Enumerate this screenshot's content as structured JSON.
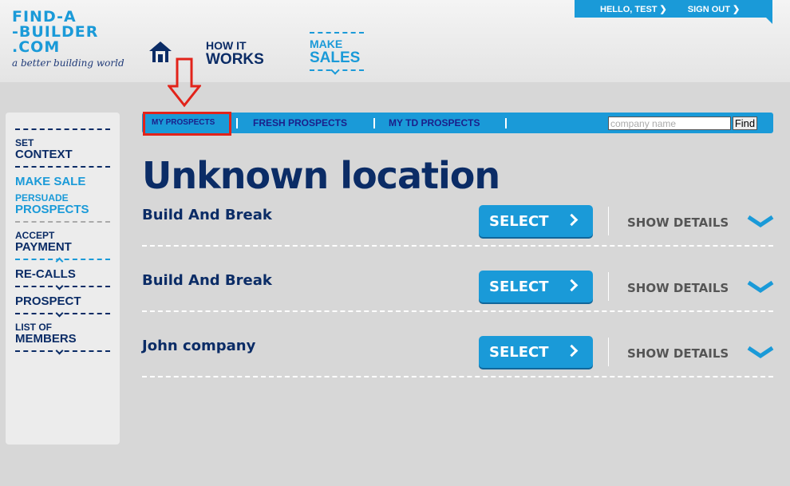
{
  "user_bar": {
    "greeting": "HELLO, TEST",
    "sign_out": "SIGN OUT"
  },
  "logo": {
    "line1": "FIND-A",
    "line2": "-BUILDER",
    "line3": ".COM",
    "tagline": "a better building world"
  },
  "top_nav": {
    "how_it_small": "HOW IT",
    "how_it_big": "WORKS",
    "make_small": "MAKE",
    "make_big": "SALES"
  },
  "sidebar": {
    "items": [
      {
        "small": "SET",
        "big": "CONTEXT"
      },
      {
        "big": "MAKE SALE"
      },
      {
        "small": "PERSUADE",
        "big": "PROSPECTS"
      },
      {
        "small": "ACCEPT",
        "big": "PAYMENT"
      },
      {
        "big": "RE-CALLS"
      },
      {
        "big": "PROSPECT"
      },
      {
        "small": "LIST OF",
        "big": "MEMBERS"
      }
    ]
  },
  "sub_nav": {
    "tabs": [
      "MY PROSPECTS",
      "FRESH PROSPECTS",
      "MY TD PROSPECTS"
    ],
    "search_placeholder": "company name",
    "find_label": "Find"
  },
  "page_title": "Unknown location",
  "prospects": [
    {
      "name": "Build And Break",
      "select_label": "SELECT",
      "details_label": "SHOW DETAILS"
    },
    {
      "name": "Build And Break",
      "select_label": "SELECT",
      "details_label": "SHOW DETAILS"
    },
    {
      "name": "John company",
      "select_label": "SELECT",
      "details_label": "SHOW DETAILS"
    }
  ],
  "colors": {
    "brand_blue": "#1a9ad8",
    "navy": "#0b2c66",
    "highlight_red": "#e2231a"
  }
}
